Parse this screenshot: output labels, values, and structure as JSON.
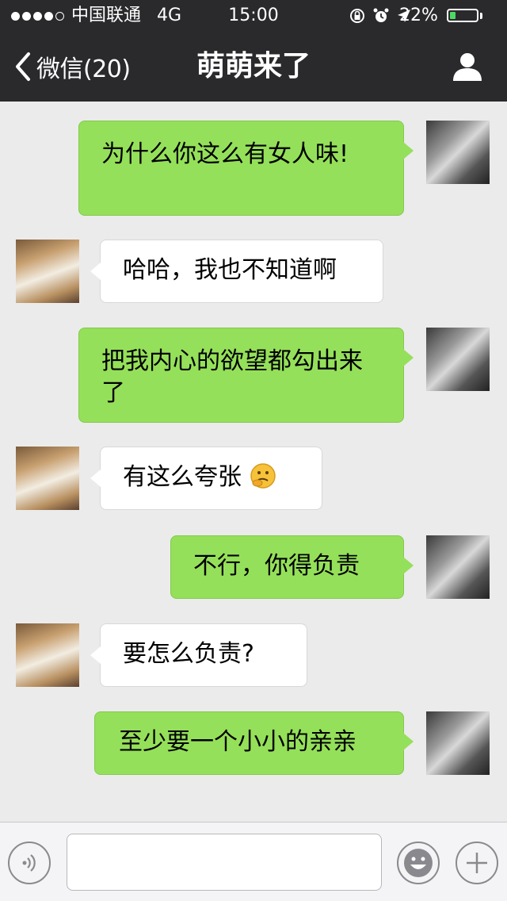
{
  "status_bar": {
    "carrier": "中国联通",
    "network": "4G",
    "time": "15:00",
    "battery": "22%",
    "battery_level": 0.22
  },
  "nav": {
    "back_label": "微信(20)",
    "title": "萌萌来了"
  },
  "messages": [
    {
      "sender": "me",
      "text": "为什么你这么有女人味!"
    },
    {
      "sender": "other",
      "text": "哈哈，我也不知道啊"
    },
    {
      "sender": "me",
      "text": "把我内心的欲望都勾出来了"
    },
    {
      "sender": "other",
      "text": "有这么夸张"
    },
    {
      "sender": "me",
      "text": "不行，你得负责"
    },
    {
      "sender": "other",
      "text": "要怎么负责?"
    },
    {
      "sender": "me",
      "text": "至少要一个小小的亲亲"
    }
  ],
  "input_bar": {
    "placeholder": ""
  },
  "colors": {
    "nav_background": "#2a2a2d",
    "chat_background": "#ebebeb",
    "my_bubble": "#95e05a",
    "other_bubble": "#ffffff",
    "battery_fill": "#4cd964"
  }
}
